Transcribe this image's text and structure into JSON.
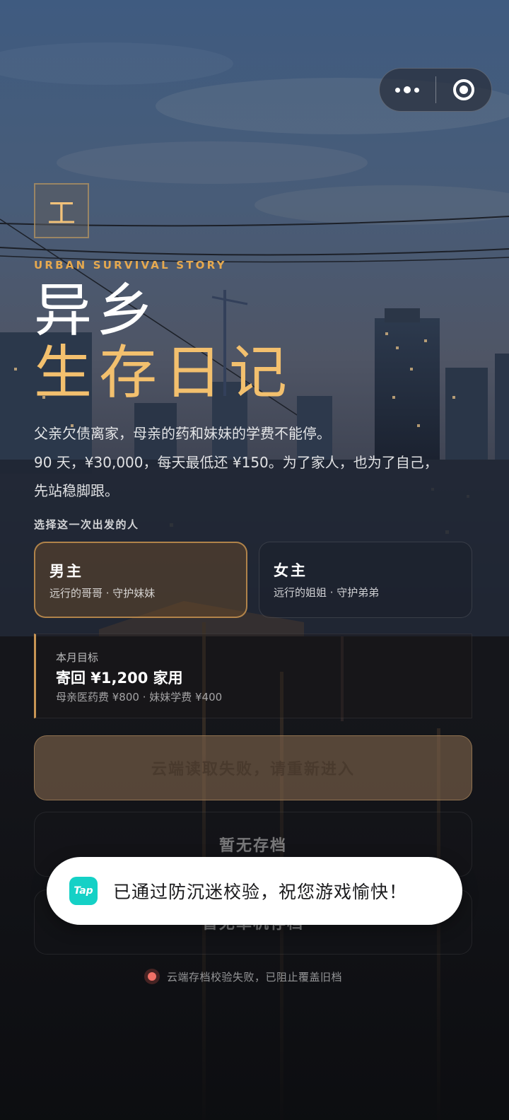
{
  "capsule": {
    "more_icon": "more-dots-icon",
    "close_icon": "target-circle-icon"
  },
  "brand": {
    "logo_char": "工"
  },
  "hero": {
    "eyebrow": "URBAN SURVIVAL STORY",
    "title_line1": "异乡",
    "title_line2": "生存日记"
  },
  "story": {
    "line1": "父亲欠债离家，母亲的药和妹妹的学费不能停。",
    "line2": "90 天，¥30,000，每天最低还 ¥150。为了家人，也为了自己，",
    "line3": "先站稳脚跟。"
  },
  "choose_label": "选择这一次出发的人",
  "characters": [
    {
      "name": "男主",
      "desc": "远行的哥哥 · 守护妹妹",
      "selected": true
    },
    {
      "name": "女主",
      "desc": "远行的姐姐 · 守护弟弟",
      "selected": false
    }
  ],
  "goal": {
    "label": "本月目标",
    "value": "寄回 ¥1,200 家用",
    "detail": "母亲医药费 ¥800 · 妹妹学费 ¥400"
  },
  "buttons": {
    "primary": "云端读取失败，请重新进入",
    "no_save": "暂无存档",
    "no_local_save": "暂无单机存档"
  },
  "toast": {
    "icon_label": "Tap",
    "message": "已通过防沉迷校验，祝您游戏愉快！"
  },
  "status": {
    "text": "云端存档校验失败，已阻止覆盖旧档"
  },
  "colors": {
    "accent": "#f3c06e",
    "accent_dark": "#c89454",
    "toast_bg": "#ffffff",
    "tap_brand": "#15d1c6",
    "error": "#f07066"
  }
}
